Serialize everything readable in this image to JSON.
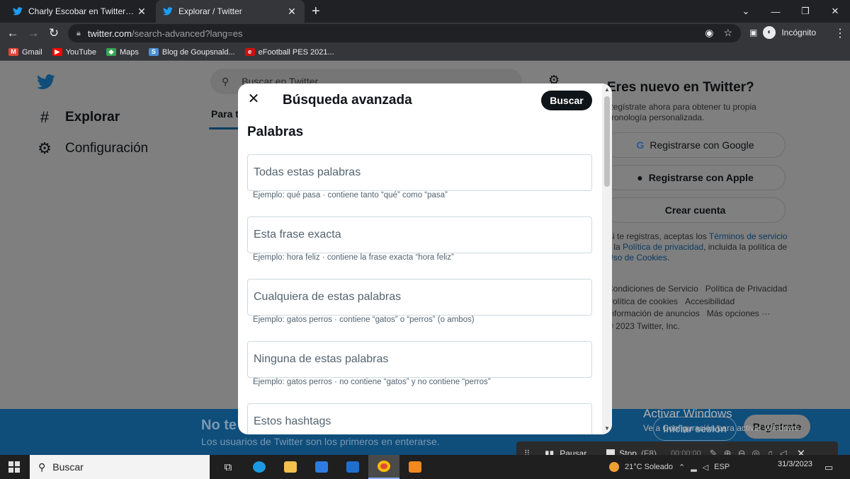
{
  "browser": {
    "tabs": [
      {
        "title": "Charly Escobar en Twitter: \"Como",
        "active": false
      },
      {
        "title": "Explorar / Twitter",
        "active": true
      }
    ],
    "new_tab_glyph": "+",
    "url_host": "twitter.com",
    "url_path": "/search-advanced?lang=es",
    "profile_label": "Incógnito",
    "bookmarks": [
      {
        "label": "Gmail",
        "icon": "gmail-icon",
        "color": "#ea4335"
      },
      {
        "label": "YouTube",
        "icon": "youtube-icon",
        "color": "#ff0000"
      },
      {
        "label": "Maps",
        "icon": "maps-icon",
        "color": "#34a853"
      },
      {
        "label": "Blog de Goupsnald...",
        "icon": "blog-icon",
        "color": "#4b8fd6"
      },
      {
        "label": "eFootball PES 2021...",
        "icon": "efootball-icon",
        "color": "#d01010"
      }
    ]
  },
  "twitter": {
    "brand_color": "#1d9bf0",
    "nav": [
      {
        "label": "Explorar",
        "icon": "hashtag-icon"
      },
      {
        "label": "Configuración",
        "icon": "gear-icon"
      }
    ],
    "search_placeholder": "Buscar en Twitter",
    "tab_partial": "Para t",
    "right": {
      "title": "Eres nuevo en Twitter?",
      "subtitle": "Regístrate ahora para obtener tu propia cronología personalizada.",
      "btn_google": "Registrarse con Google",
      "btn_apple": "Registrarse con Apple",
      "btn_create": "Crear cuenta",
      "legal_pre": "Si te registras, aceptas los ",
      "legal_terms": "Términos de servicio",
      "legal_mid": " y la ",
      "legal_privacy": "Política de privacidad",
      "legal_mid2": ", incluida la política de ",
      "legal_cookies": "Uso de Cookies",
      "legal_end": ".",
      "footer": [
        "Condiciones de Servicio",
        "Política de Privacidad",
        "Política de cookies",
        "Accesibilidad",
        "Información de anuncios",
        "Más opciones ···",
        "© 2023 Twitter, Inc."
      ]
    },
    "signup_bar": {
      "title": "No te pierdas lo que está pasando",
      "subtitle": "Los usuarios de Twitter son los primeros en enterarse.",
      "login": "Iniciar sesión",
      "register": "Regístrate"
    }
  },
  "modal": {
    "title": "Búsqueda avanzada",
    "search_button": "Buscar",
    "section": "Palabras",
    "fields": [
      {
        "placeholder": "Todas estas palabras",
        "hint": "Ejemplo: qué pasa · contiene tanto “qué” como “pasa”"
      },
      {
        "placeholder": "Esta frase exacta",
        "hint": "Ejemplo: hora feliz · contiene la frase exacta “hora feliz”"
      },
      {
        "placeholder": "Cualquiera de estas palabras",
        "hint": "Ejemplo: gatos perros · contiene “gatos” o “perros” (o ambos)"
      },
      {
        "placeholder": "Ninguna de estas palabras",
        "hint": "Ejemplo: gatos perros · no contiene “gatos” y no contiene “perros”"
      },
      {
        "placeholder": "Estos hashtags",
        "hint": ""
      }
    ]
  },
  "windows": {
    "activate_title": "Activar Windows",
    "activate_sub": "Ve a Configuración para activar Windows.",
    "search": "Buscar",
    "weather": "21°C  Soleado",
    "lang": "ESP",
    "time": "",
    "date": "31/3/2023"
  },
  "recorder": {
    "pause": "Pausar",
    "stop": "Stop",
    "stop_key": "(F8)",
    "time": "00:00:00"
  }
}
